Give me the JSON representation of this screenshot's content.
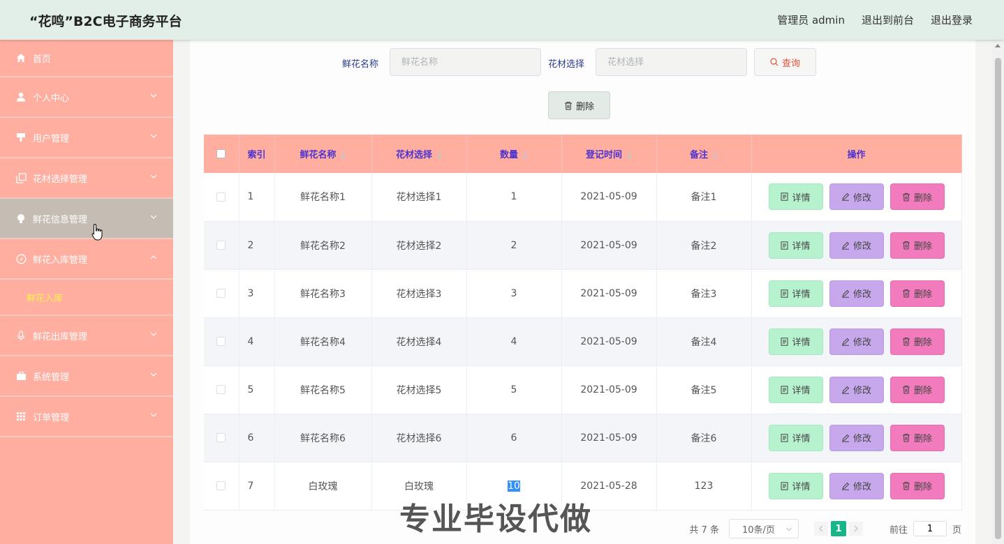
{
  "header": {
    "title": "“花鸣”B2C电子商务平台",
    "links": [
      "管理员 admin",
      "退出到前台",
      "退出登录"
    ]
  },
  "sidebar": {
    "items": [
      {
        "label": "首页",
        "icon": "home-icon"
      },
      {
        "label": "个人中心",
        "icon": "user-icon"
      },
      {
        "label": "用户管理",
        "icon": "stamp-icon"
      },
      {
        "label": "花材选择管理",
        "icon": "copy-icon"
      },
      {
        "label": "鲜花信息管理",
        "icon": "bulb-icon"
      },
      {
        "label": "鲜花入库管理",
        "icon": "compass-icon"
      },
      {
        "label": "鲜花出库管理",
        "icon": "mic-icon"
      },
      {
        "label": "系统管理",
        "icon": "briefcase-icon"
      },
      {
        "label": "订单管理",
        "icon": "grid-icon"
      }
    ],
    "submenu_label": "鲜花入库"
  },
  "search": {
    "name_label": "鲜花名称",
    "name_placeholder": "鲜花名称",
    "material_label": "花材选择",
    "material_placeholder": "花材选择",
    "query_label": "查询",
    "delete_label": "删除"
  },
  "table": {
    "headers": [
      "索引",
      "鲜花名称",
      "花材选择",
      "数量",
      "登记时间",
      "备注",
      "操作"
    ],
    "rows": [
      {
        "index": "1",
        "name": "鲜花名称1",
        "material": "花材选择1",
        "qty": "1",
        "date": "2021-05-09",
        "note": "备注1"
      },
      {
        "index": "2",
        "name": "鲜花名称2",
        "material": "花材选择2",
        "qty": "2",
        "date": "2021-05-09",
        "note": "备注2"
      },
      {
        "index": "3",
        "name": "鲜花名称3",
        "material": "花材选择3",
        "qty": "3",
        "date": "2021-05-09",
        "note": "备注3"
      },
      {
        "index": "4",
        "name": "鲜花名称4",
        "material": "花材选择4",
        "qty": "4",
        "date": "2021-05-09",
        "note": "备注4"
      },
      {
        "index": "5",
        "name": "鲜花名称5",
        "material": "花材选择5",
        "qty": "5",
        "date": "2021-05-09",
        "note": "备注5"
      },
      {
        "index": "6",
        "name": "鲜花名称6",
        "material": "花材选择6",
        "qty": "6",
        "date": "2021-05-09",
        "note": "备注6"
      },
      {
        "index": "7",
        "name": "白玫瑰",
        "material": "白玫瑰",
        "qty": "10",
        "date": "2021-05-28",
        "note": "123"
      }
    ],
    "actions": {
      "detail": "详情",
      "edit": "修改",
      "delete": "删除"
    }
  },
  "pager": {
    "total": "共 7 条",
    "size": "10条/页",
    "current": "1",
    "goto_prefix": "前往",
    "goto_value": "1",
    "goto_suffix": "页"
  },
  "watermark": "专业毕设代做",
  "colors": {
    "header_bg": "#e2efe8",
    "sidebar_bg": "#ffaea0",
    "sidebar_active": "#c5bdb4",
    "submenu_text": "#fff34f",
    "table_header_text": "#4c33cf",
    "detail_btn": "#b7f2cf",
    "edit_btn": "#c8a8ec",
    "delete_btn": "#f17bbd",
    "pager_active": "#16b686"
  }
}
